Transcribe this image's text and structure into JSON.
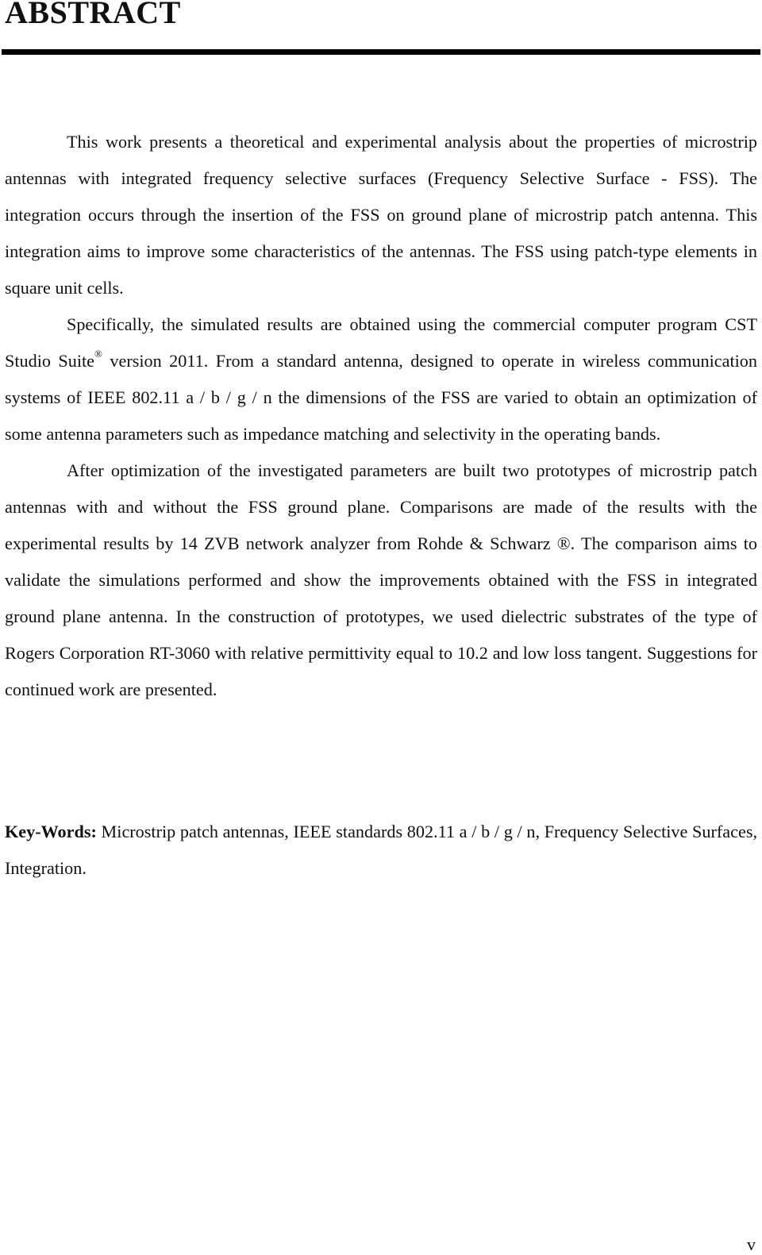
{
  "heading": {
    "title": "ABSTRACT"
  },
  "abstract": {
    "paragraph1": "This work presents a theoretical and experimental analysis about the properties of microstrip antennas with integrated frequency selective surfaces (Frequency Selective Surface - FSS). The integration occurs through the insertion of the FSS on ground plane of microstrip patch antenna. This integration aims to improve some characteristics of the antennas. The FSS using patch-type elements in square unit cells.",
    "paragraph2_before_mark": "Specifically, the simulated results are obtained using the commercial computer program CST Studio Suite",
    "registered_mark": "®",
    "paragraph2_after_mark": " version 2011. From a standard antenna, designed to operate in wireless communication systems of IEEE 802.11 a / b / g / n the dimensions of the FSS are varied to obtain an optimization of some antenna parameters such as impedance matching and selectivity in the operating bands.",
    "paragraph3": "After optimization of the investigated parameters are built two prototypes of microstrip patch antennas with and without the FSS ground plane. Comparisons are made of the results with the experimental results by 14 ZVB network analyzer from Rohde & Schwarz ®. The comparison aims to validate the simulations performed and show the improvements obtained with the FSS in integrated ground plane antenna. In the construction of prototypes, we used dielectric substrates of the type of Rogers Corporation RT-3060 with relative permittivity equal to 10.2 and low loss tangent. Suggestions for continued work are presented."
  },
  "keywords": {
    "label": "Key-Words:",
    "text": " Microstrip patch antennas, IEEE standards 802.11 a / b / g / n, Frequency Selective Surfaces, Integration."
  },
  "footer": {
    "page_number": "v"
  }
}
